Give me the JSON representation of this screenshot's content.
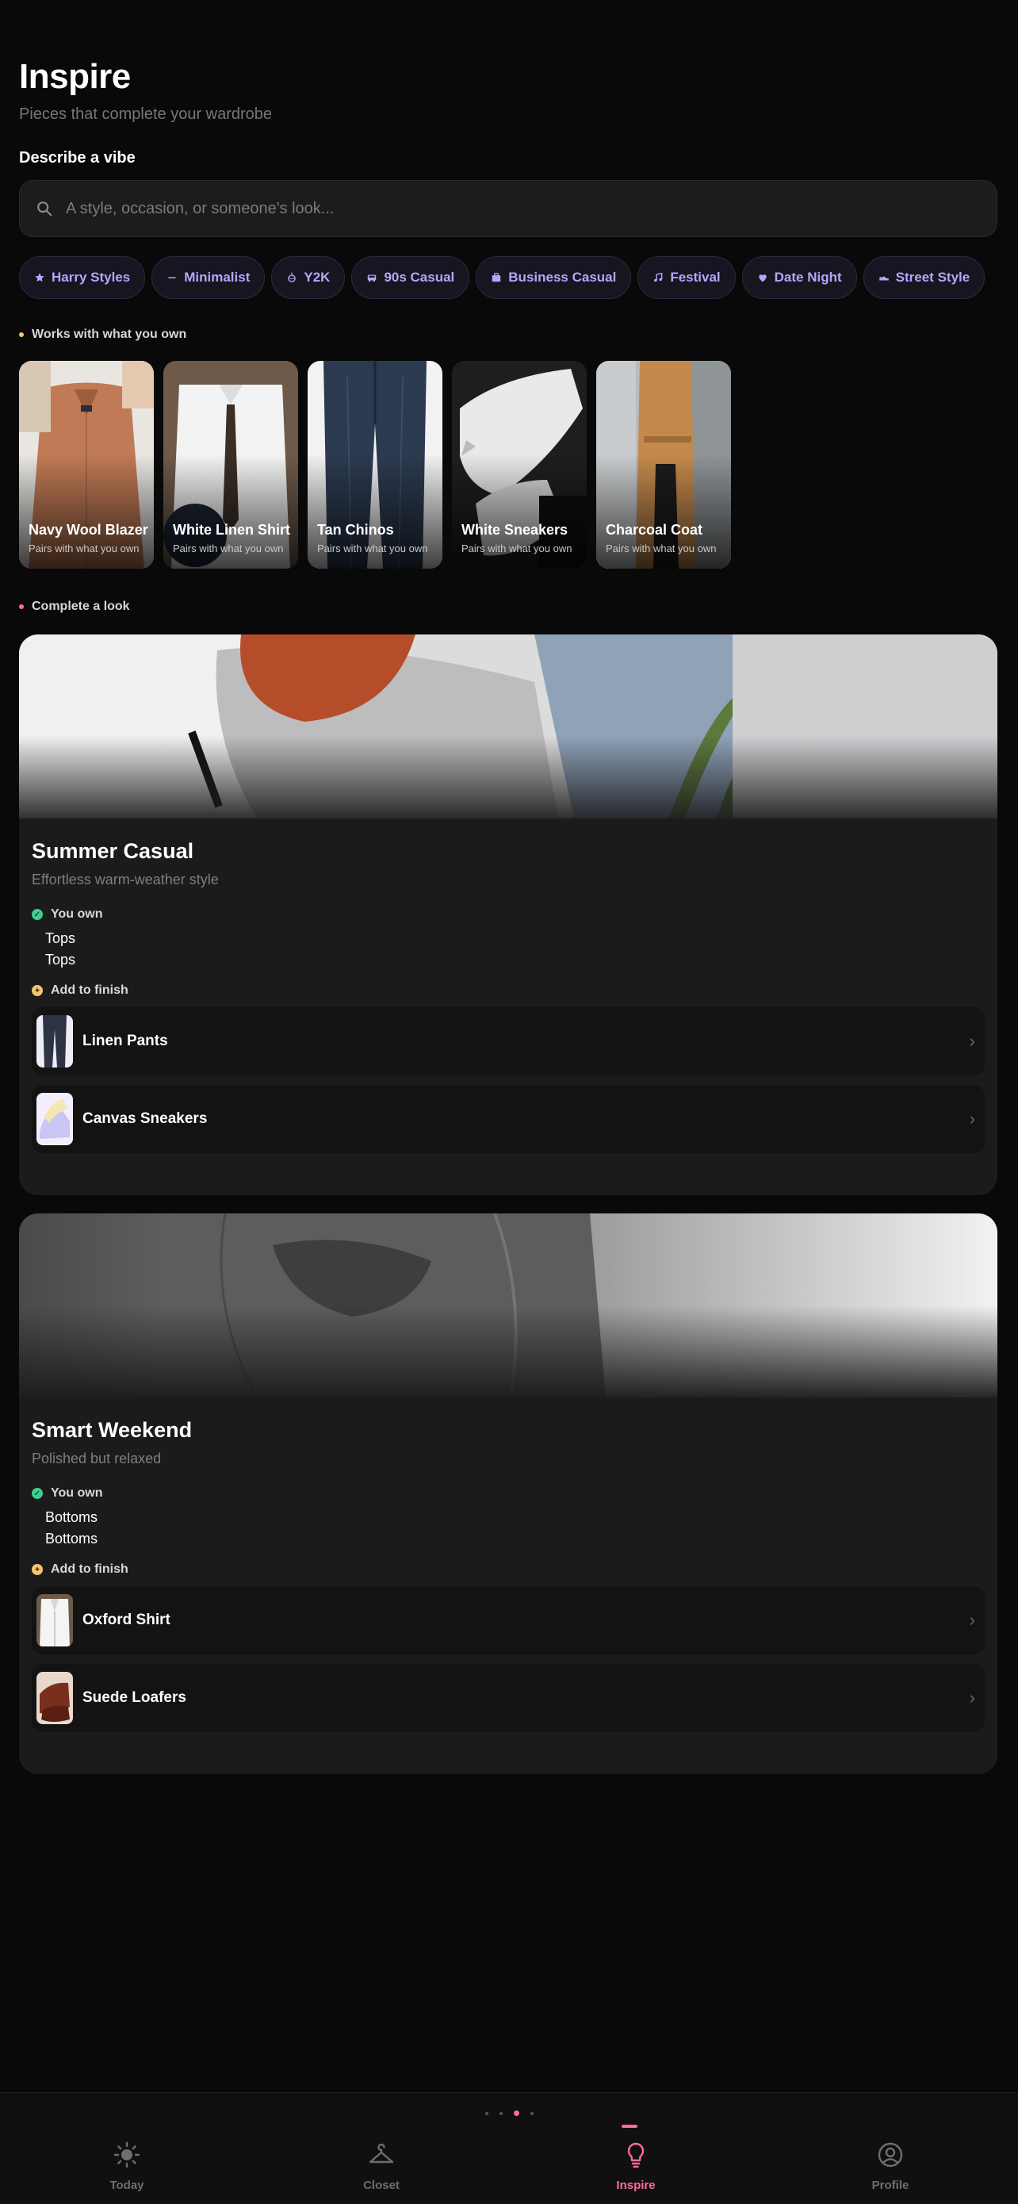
{
  "header": {
    "title": "Inspire",
    "subtitle": "Pieces that complete your wardrobe"
  },
  "vibe": {
    "label": "Describe a vibe",
    "placeholder": "A style, occasion, or someone's look..."
  },
  "chips": [
    {
      "label": "Harry Styles",
      "icon": "star-icon"
    },
    {
      "label": "Minimalist",
      "icon": "minus-icon"
    },
    {
      "label": "Y2K",
      "icon": "disco-icon"
    },
    {
      "label": "90s Casual",
      "icon": "car-icon"
    },
    {
      "label": "Business Casual",
      "icon": "briefcase-icon"
    },
    {
      "label": "Festival",
      "icon": "music-note-icon"
    },
    {
      "label": "Date Night",
      "icon": "heart-icon"
    },
    {
      "label": "Street Style",
      "icon": "sneaker-icon"
    }
  ],
  "works_with": {
    "label": "Works with what you own",
    "dot_color": "#f5c56b",
    "items": [
      {
        "name": "Navy Wool Blazer",
        "hint": "Pairs with what you own"
      },
      {
        "name": "White Linen Shirt",
        "hint": "Pairs with what you own"
      },
      {
        "name": "Tan Chinos",
        "hint": "Pairs with what you own"
      },
      {
        "name": "White Sneakers",
        "hint": "Pairs with what you own"
      },
      {
        "name": "Charcoal Coat",
        "hint": "Pairs with what you own"
      }
    ]
  },
  "complete_look": {
    "label": "Complete a look",
    "dot_color": "#ff6b9b",
    "looks": [
      {
        "title": "Summer Casual",
        "subtitle": "Effortless warm-weather style",
        "owned_label": "You own",
        "owned": [
          "Tops",
          "Tops"
        ],
        "add_label": "Add to finish",
        "items": [
          {
            "name": "Linen Pants"
          },
          {
            "name": "Canvas Sneakers"
          }
        ]
      },
      {
        "title": "Smart Weekend",
        "subtitle": "Polished but relaxed",
        "owned_label": "You own",
        "owned": [
          "Bottoms",
          "Bottoms"
        ],
        "add_label": "Add to finish",
        "items": [
          {
            "name": "Oxford Shirt"
          },
          {
            "name": "Suede Loafers"
          }
        ]
      }
    ]
  },
  "nav": {
    "tabs": [
      {
        "label": "Today",
        "icon": "sun-icon"
      },
      {
        "label": "Closet",
        "icon": "hanger-icon"
      },
      {
        "label": "Inspire",
        "icon": "lightbulb-icon"
      },
      {
        "label": "Profile",
        "icon": "user-circle-icon"
      }
    ],
    "active": "Inspire",
    "accent": "#ff6b9b"
  },
  "colors": {
    "background": "#090909",
    "chip_text": "#b3a7ff",
    "owned_badge": "#3ecf8e",
    "add_badge": "#f5c56b"
  }
}
